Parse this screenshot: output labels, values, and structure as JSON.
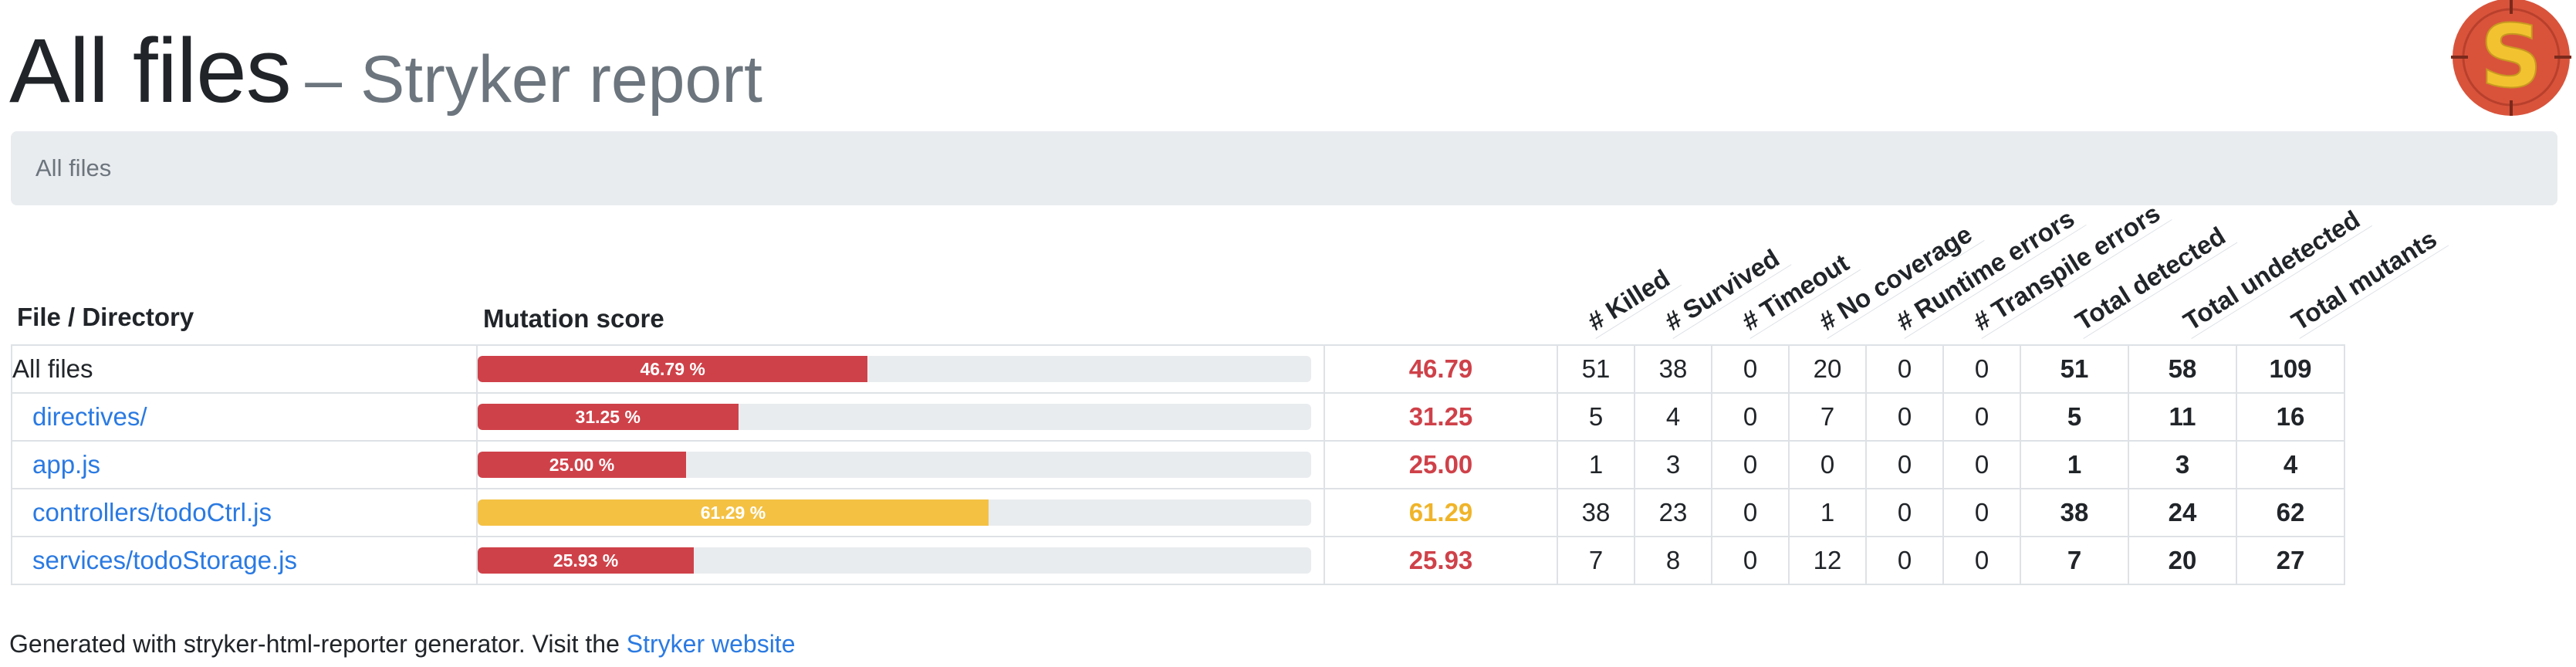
{
  "header": {
    "title": "All files",
    "subtitle": "– Stryker report"
  },
  "breadcrumb": {
    "label": "All files"
  },
  "table": {
    "file_header": "File / Directory",
    "score_header": "Mutation score",
    "column_headers": [
      "# Killed",
      "# Survived",
      "# Timeout",
      "# No coverage",
      "# Runtime errors",
      "# Transpile errors",
      "Total detected",
      "Total undetected",
      "Total mutants"
    ],
    "rows": [
      {
        "name": "All files",
        "is_link": false,
        "score": "46.79",
        "score_pct": 46.79,
        "bar_label": "46.79 %",
        "color": "#cf4149",
        "killed": "51",
        "survived": "38",
        "timeout": "0",
        "no_coverage": "20",
        "runtime_errors": "0",
        "transpile_errors": "0",
        "total_detected": "51",
        "total_undetected": "58",
        "total_mutants": "109"
      },
      {
        "name": "directives/",
        "is_link": true,
        "score": "31.25",
        "score_pct": 31.25,
        "bar_label": "31.25 %",
        "color": "#cf4149",
        "killed": "5",
        "survived": "4",
        "timeout": "0",
        "no_coverage": "7",
        "runtime_errors": "0",
        "transpile_errors": "0",
        "total_detected": "5",
        "total_undetected": "11",
        "total_mutants": "16"
      },
      {
        "name": "app.js",
        "is_link": true,
        "score": "25.00",
        "score_pct": 25.0,
        "bar_label": "25.00 %",
        "color": "#cf4149",
        "killed": "1",
        "survived": "3",
        "timeout": "0",
        "no_coverage": "0",
        "runtime_errors": "0",
        "transpile_errors": "0",
        "total_detected": "1",
        "total_undetected": "3",
        "total_mutants": "4"
      },
      {
        "name": "controllers/todoCtrl.js",
        "is_link": true,
        "score": "61.29",
        "score_pct": 61.29,
        "bar_label": "61.29 %",
        "color": "#f4c143",
        "killed": "38",
        "survived": "23",
        "timeout": "0",
        "no_coverage": "1",
        "runtime_errors": "0",
        "transpile_errors": "0",
        "total_detected": "38",
        "total_undetected": "24",
        "total_mutants": "62"
      },
      {
        "name": "services/todoStorage.js",
        "is_link": true,
        "score": "25.93",
        "score_pct": 25.93,
        "bar_label": "25.93 %",
        "color": "#cf4149",
        "killed": "7",
        "survived": "8",
        "timeout": "0",
        "no_coverage": "12",
        "runtime_errors": "0",
        "transpile_errors": "0",
        "total_detected": "7",
        "total_undetected": "20",
        "total_mutants": "27"
      }
    ]
  },
  "footer": {
    "text": "Generated with stryker-html-reporter generator. Visit the ",
    "link_text": "Stryker website"
  },
  "logo": {
    "letter": "S",
    "icon": "stryker-logo-icon",
    "colors": {
      "ring": "#d9533b",
      "letter": "#f3c230"
    }
  }
}
